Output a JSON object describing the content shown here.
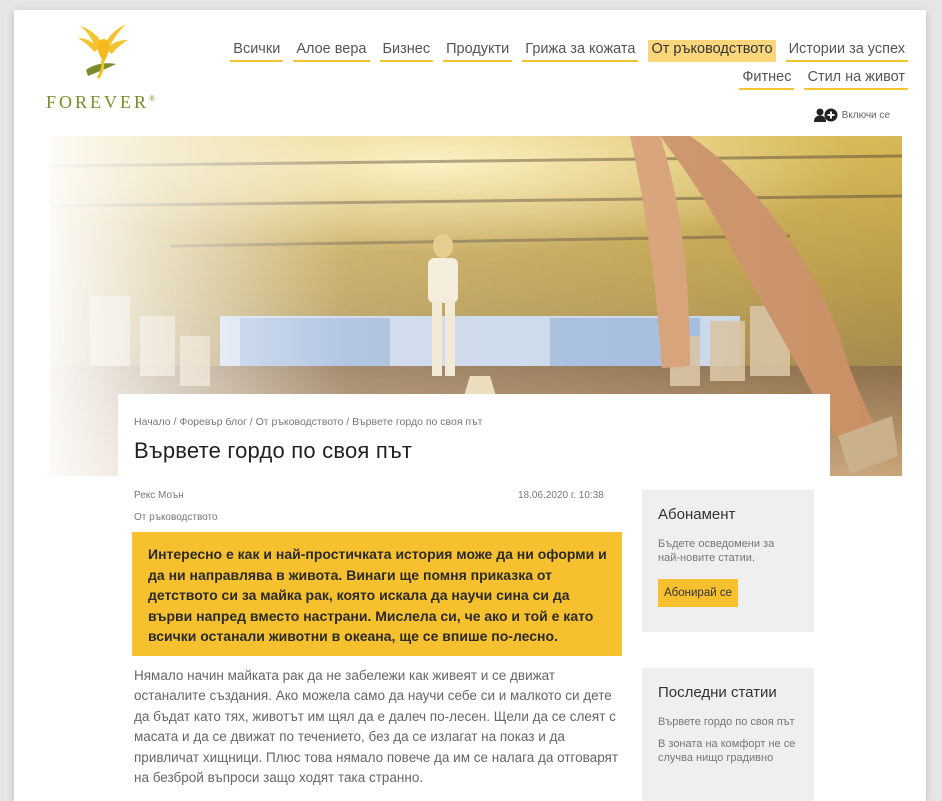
{
  "brand": {
    "logo_text": "FOREVER",
    "reg_mark": "®"
  },
  "nav": {
    "row1": [
      {
        "label": "Всички"
      },
      {
        "label": "Алое вера"
      },
      {
        "label": "Бизнес"
      },
      {
        "label": "Продукти"
      },
      {
        "label": "Грижа за кожата"
      },
      {
        "label": "От ръководството",
        "active": true
      },
      {
        "label": "Истории за успех"
      }
    ],
    "row2": [
      {
        "label": "Фитнес"
      },
      {
        "label": "Стил на живот"
      }
    ]
  },
  "join": {
    "label": "Включи се",
    "icon": "person-add-icon"
  },
  "breadcrumb": {
    "items": [
      "Начало",
      "Форевър блог",
      "От ръководството",
      "Вървете гордо по своя път"
    ],
    "separator": " / "
  },
  "article": {
    "title": "Вървете гордо по своя път",
    "author": "Рекс Моън",
    "date": "18.06.2020 г. 10:38",
    "category": "От ръководството",
    "quote": "Интересно е как и най-простичката история може да ни оформи и да ни направлява в живота. Винаги ще помня приказка от детството си за майка рак, която искала да научи сина си да върви напред вместо настрани. Мислела си, че ако и той е като всички останали животни в океана, ще се впише по-лесно.",
    "body": "Нямало начин майката рак да не забележи как живеят и се движат останалите създания. Ако можела само да научи себе си и малкото си дете да бъдат като тях, животът им щял да е далеч по-лесен. Щели да се слеят с масата и да се движат по течението, без да се излагат на показ и да привличат хищници. Плюс това нямало повече да им се налага да отговарят на безброй въпроси защо ходят така странно."
  },
  "sidebar": {
    "subscribe": {
      "title": "Абонамент",
      "text": "Бъдете осведомени за най-новите статии.",
      "button": "Абонирай се"
    },
    "latest": {
      "title": "Последни статии",
      "items": [
        "Вървете гордо по своя път",
        "В зоната на комфорт не се случва нищо градивно"
      ]
    }
  },
  "colors": {
    "accent": "#f7c02e",
    "nav_underline": "#f4c430",
    "logo": "#7c8b2b"
  }
}
